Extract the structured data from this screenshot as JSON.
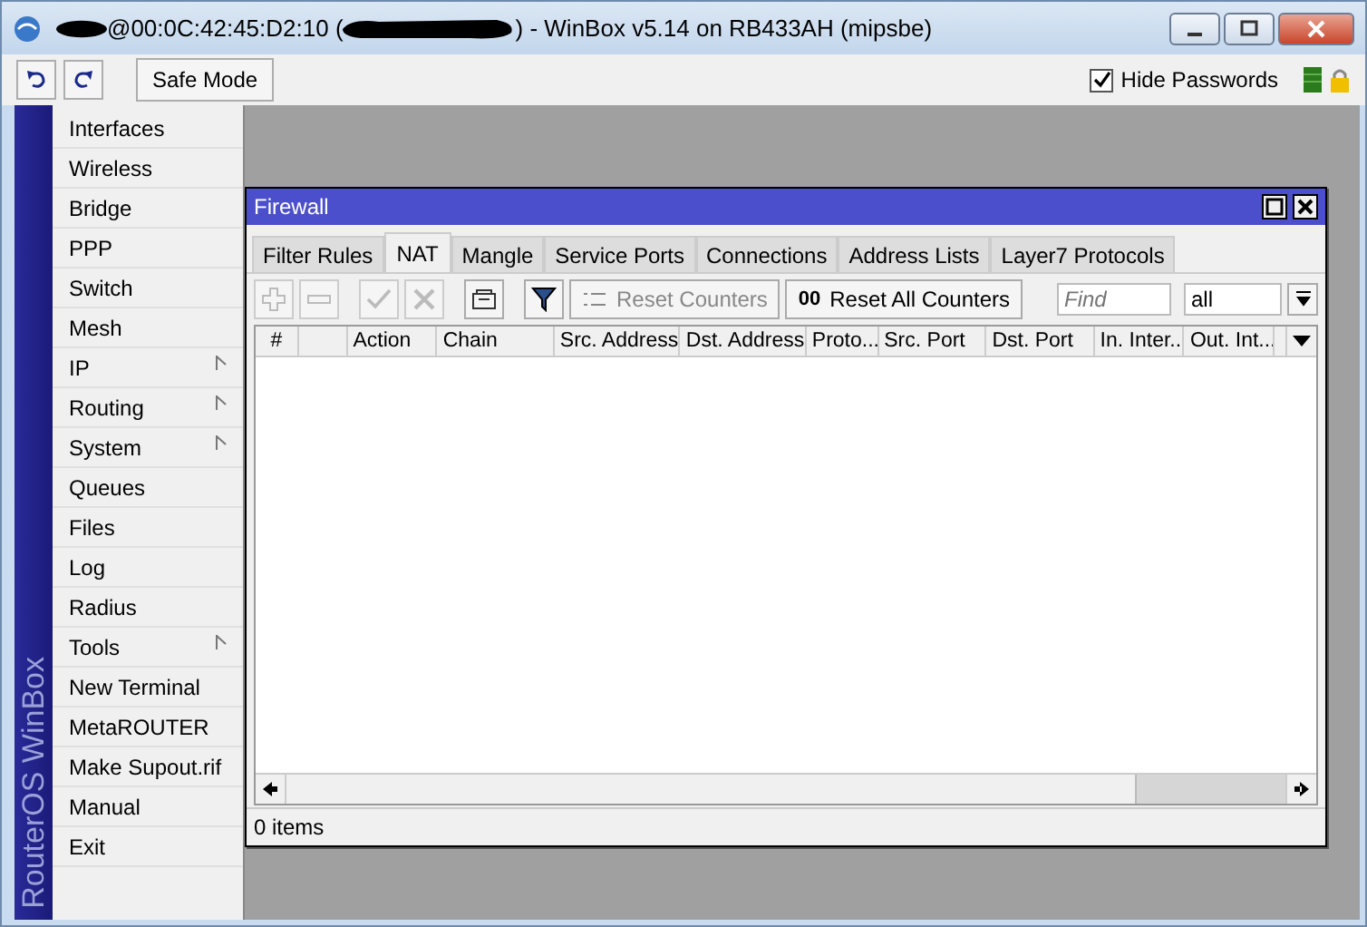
{
  "window": {
    "title_start": "@00:0C:42:45:D2:10 (",
    "title_end": ") - WinBox v5.14 on RB433AH (mipsbe)"
  },
  "toolbar": {
    "safe_mode": "Safe Mode",
    "hide_passwords": {
      "label": "Hide Passwords",
      "checked": true
    }
  },
  "sidebar": {
    "brand": "RouterOS WinBox",
    "items": [
      {
        "label": "Interfaces",
        "submenu": false
      },
      {
        "label": "Wireless",
        "submenu": false
      },
      {
        "label": "Bridge",
        "submenu": false
      },
      {
        "label": "PPP",
        "submenu": false
      },
      {
        "label": "Switch",
        "submenu": false
      },
      {
        "label": "Mesh",
        "submenu": false
      },
      {
        "label": "IP",
        "submenu": true
      },
      {
        "label": "Routing",
        "submenu": true
      },
      {
        "label": "System",
        "submenu": true
      },
      {
        "label": "Queues",
        "submenu": false
      },
      {
        "label": "Files",
        "submenu": false
      },
      {
        "label": "Log",
        "submenu": false
      },
      {
        "label": "Radius",
        "submenu": false
      },
      {
        "label": "Tools",
        "submenu": true
      },
      {
        "label": "New Terminal",
        "submenu": false
      },
      {
        "label": "MetaROUTER",
        "submenu": false
      },
      {
        "label": "Make Supout.rif",
        "submenu": false
      },
      {
        "label": "Manual",
        "submenu": false
      },
      {
        "label": "Exit",
        "submenu": false
      }
    ]
  },
  "firewall": {
    "title": "Firewall",
    "tabs": [
      {
        "label": "Filter Rules",
        "selected": false
      },
      {
        "label": "NAT",
        "selected": true
      },
      {
        "label": "Mangle",
        "selected": false
      },
      {
        "label": "Service Ports",
        "selected": false
      },
      {
        "label": "Connections",
        "selected": false
      },
      {
        "label": "Address Lists",
        "selected": false
      },
      {
        "label": "Layer7 Protocols",
        "selected": false
      }
    ],
    "tools": [
      {
        "kind": "add",
        "disabled": true
      },
      {
        "kind": "remove",
        "disabled": true
      },
      {
        "kind": "enable",
        "disabled": true
      },
      {
        "kind": "disable",
        "disabled": true
      },
      {
        "kind": "comment",
        "disabled": false
      },
      {
        "kind": "filter",
        "disabled": false
      }
    ],
    "reset_counters": {
      "label": "Reset Counters",
      "disabled": true
    },
    "reset_all": {
      "icon_text": "00",
      "label": "Reset All Counters"
    },
    "find": {
      "placeholder": "Find"
    },
    "filter_value": "all",
    "columns": [
      "#",
      "Action",
      "Chain",
      "Src. Address",
      "Dst. Address",
      "Proto...",
      "Src. Port",
      "Dst. Port",
      "In. Inter...",
      "Out. Int..."
    ],
    "status": "0 items"
  }
}
